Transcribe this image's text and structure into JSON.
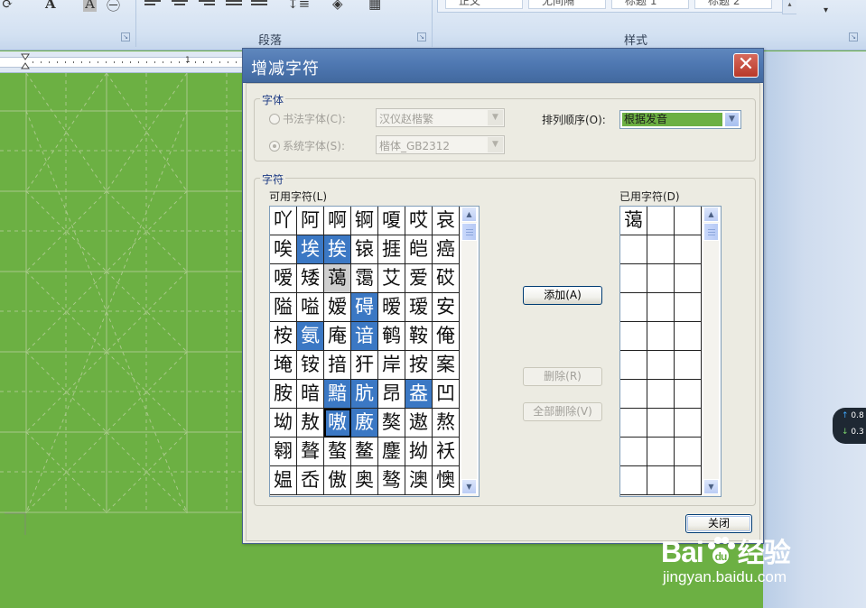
{
  "ribbon": {
    "groups": {
      "paragraph_label": "段落",
      "styles_label": "样式"
    },
    "style_gallery": [
      "正文",
      "无间隔",
      "标题 1",
      "标题 2"
    ]
  },
  "ruler": {
    "number": "1"
  },
  "floating_widget": {
    "up_value": "0.8",
    "down_value": "0.3"
  },
  "dialog": {
    "title": "增减字符",
    "font_group": {
      "title": "字体",
      "calligraphy_font_label": "书法字体(C):",
      "calligraphy_font_value": "汉仪赵楷繁",
      "system_font_label": "系统字体(S):",
      "system_font_value": "楷体_GB2312",
      "sort_label": "排列顺序(O):",
      "sort_value": "根据发音"
    },
    "chars_group": {
      "title": "字符",
      "available_label": "可用字符(L)",
      "used_label": "已用字符(D)",
      "available_rows": [
        [
          "吖",
          "阿",
          "啊",
          "锕",
          "嗄",
          "哎",
          "哀"
        ],
        [
          "唉",
          "埃",
          "挨",
          "锿",
          "捱",
          "皑",
          "癌"
        ],
        [
          "嗳",
          "矮",
          "蔼",
          "霭",
          "艾",
          "爱",
          "砹"
        ],
        [
          "隘",
          "嗌",
          "嫒",
          "碍",
          "暧",
          "瑷",
          "安"
        ],
        [
          "桉",
          "氨",
          "庵",
          "谙",
          "鹌",
          "鞍",
          "俺"
        ],
        [
          "埯",
          "铵",
          "揞",
          "犴",
          "岸",
          "按",
          "案"
        ],
        [
          "胺",
          "暗",
          "黯",
          "肮",
          "昂",
          "盎",
          "凹"
        ],
        [
          "坳",
          "敖",
          "嗷",
          "廒",
          "獒",
          "遨",
          "熬"
        ],
        [
          "翱",
          "聱",
          "螯",
          "鳌",
          "鏖",
          "拗",
          "袄"
        ],
        [
          "媪",
          "岙",
          "傲",
          "奥",
          "骜",
          "澳",
          "懊"
        ]
      ],
      "available_selected": [
        "1-1",
        "1-2",
        "4-1",
        "3-3",
        "4-3",
        "6-2",
        "6-3",
        "6-5",
        "7-3"
      ],
      "available_current": "7-2",
      "available_gray": [
        "2-2"
      ],
      "used_chars": [
        "蔼"
      ]
    },
    "buttons": {
      "add": "添加(A)",
      "remove": "删除(R)",
      "remove_all": "全部删除(V)",
      "close": "关闭"
    }
  },
  "watermark": {
    "brand_left": "Bai",
    "brand_right": "经验",
    "url": "jingyan.baidu.com"
  },
  "colors": {
    "page_green": "#6cb043",
    "titlebar_blue": "#4f78b2",
    "selection_blue": "#3b78c4"
  }
}
